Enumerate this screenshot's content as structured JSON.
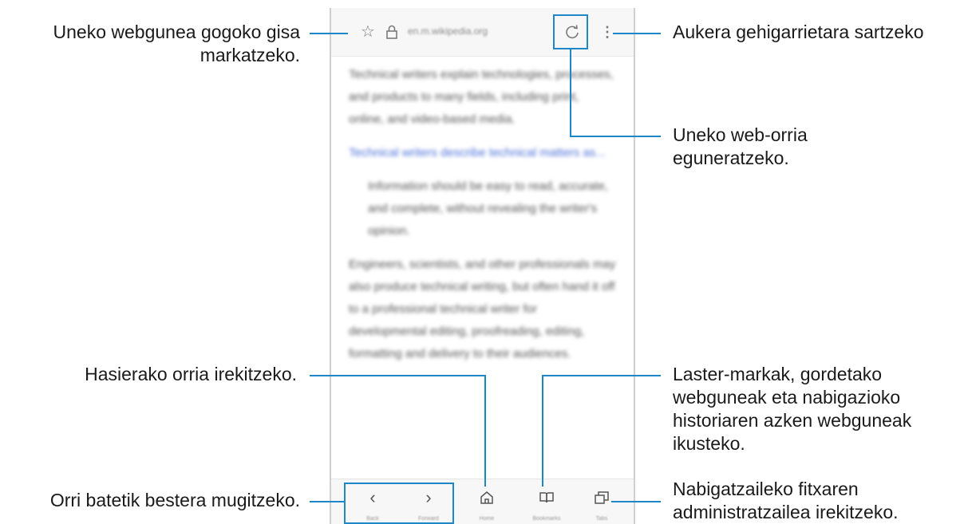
{
  "browser": {
    "address_bar": {
      "url": "en.m.wikipedia.org",
      "bookmark_icon": "star-icon",
      "lock_icon": "lock-icon",
      "refresh_icon": "refresh-icon",
      "menu_icon": "more-vertical-icon"
    },
    "content_paragraphs": [
      "Technical writers explain technologies, processes, and products to many fields, including print, online, and video-based media.",
      "Technical writers describe technical matters as...",
      "Information should be easy to read, accurate, and complete, without revealing the writer's opinion.",
      "Engineers, scientists, and other professionals may also produce technical writing, but often hand it off to a professional technical writer for developmental editing, proofreading, editing, formatting and delivery to their audiences."
    ],
    "bottom_nav": {
      "back_label": "Back",
      "forward_label": "Forward",
      "home_label": "Home",
      "bookmarks_label": "Bookmarks",
      "tabs_label": "Tabs"
    }
  },
  "callouts": {
    "bookmark": [
      "Uneko webgunea gogoko gisa",
      "markatzeko."
    ],
    "more_options": [
      "Aukera gehigarrietara sartzeko"
    ],
    "refresh": [
      "Uneko web-orria",
      "eguneratzeko."
    ],
    "home": [
      "Hasierako orria irekitzeko."
    ],
    "bookmarks": [
      "Laster-markak, gordetako",
      "webguneak eta nabigazioko",
      "historiaren azken webguneak",
      "ikusteko."
    ],
    "navigate": [
      "Orri batetik bestera mugitzeko."
    ],
    "tabs": [
      "Nabigatzaileko fitxaren",
      "administratzailea irekitzeko."
    ]
  },
  "colors": {
    "callout_line": "#1e87c8",
    "text": "#1a1a1a"
  }
}
